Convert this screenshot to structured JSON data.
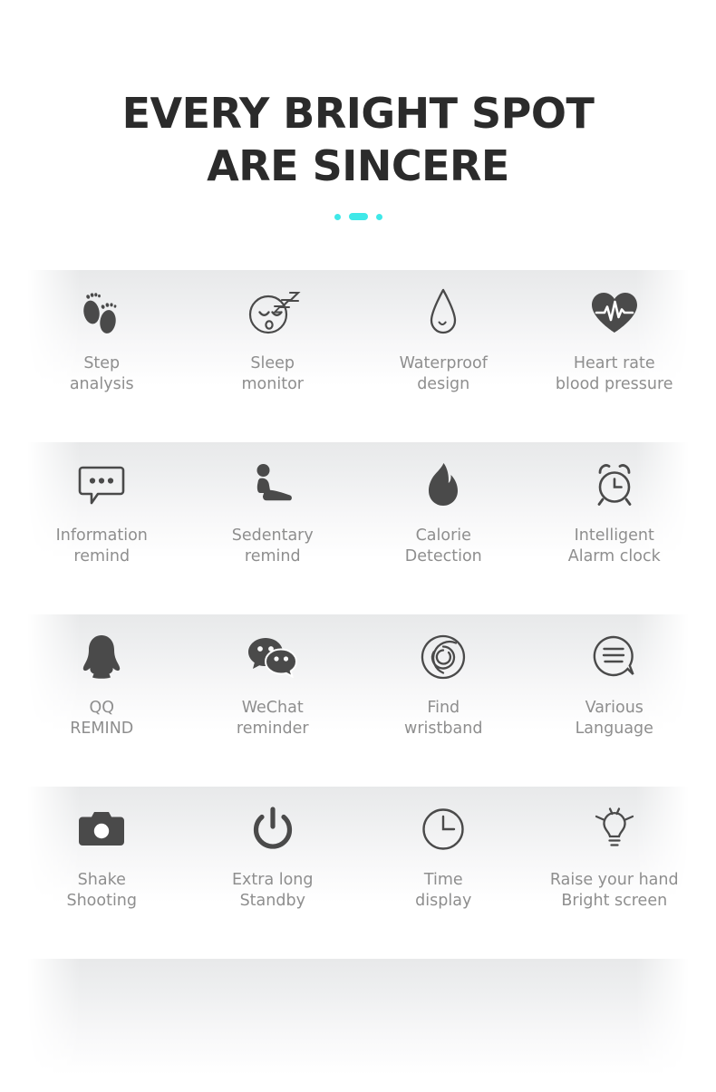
{
  "header": {
    "title_line1": "EVERY BRIGHT SPOT",
    "title_line2": "ARE SINCERE",
    "accent_color": "#3fe8e8",
    "title_color": "#2b2b2b",
    "indicator": {
      "dot1": "",
      "dot2": "",
      "dot3": ""
    }
  },
  "theme": {
    "icon_color": "#4a4a4a",
    "label_color": "#8e8e8e",
    "band_color": "#e8e9ea",
    "background": "#ffffff"
  },
  "rows": [
    {
      "cells": [
        {
          "icon": "footprints-icon",
          "label": "Step\nanalysis"
        },
        {
          "icon": "sleeping-face-icon",
          "label": "Sleep\nmonitor"
        },
        {
          "icon": "water-drop-icon",
          "label": "Waterproof\ndesign"
        },
        {
          "icon": "heart-pulse-icon",
          "label": "Heart rate\nblood pressure"
        }
      ]
    },
    {
      "cells": [
        {
          "icon": "message-bubble-icon",
          "label": "Information\nremind"
        },
        {
          "icon": "seated-person-icon",
          "label": "Sedentary\nremind"
        },
        {
          "icon": "flame-icon",
          "label": "Calorie\nDetection"
        },
        {
          "icon": "alarm-clock-icon",
          "label": "Intelligent\nAlarm clock"
        }
      ]
    },
    {
      "cells": [
        {
          "icon": "qq-penguin-icon",
          "label": "QQ\nREMIND"
        },
        {
          "icon": "wechat-bubbles-icon",
          "label": "WeChat\nreminder"
        },
        {
          "icon": "radar-rings-icon",
          "label": "Find\nwristband"
        },
        {
          "icon": "language-bubble-icon",
          "label": "Various\nLanguage"
        }
      ]
    },
    {
      "cells": [
        {
          "icon": "camera-icon",
          "label": "Shake\nShooting"
        },
        {
          "icon": "power-icon",
          "label": "Extra long\nStandby"
        },
        {
          "icon": "clock-icon",
          "label": "Time\ndisplay"
        },
        {
          "icon": "light-bulb-icon",
          "label": "Raise your hand\nBright screen"
        }
      ]
    }
  ]
}
